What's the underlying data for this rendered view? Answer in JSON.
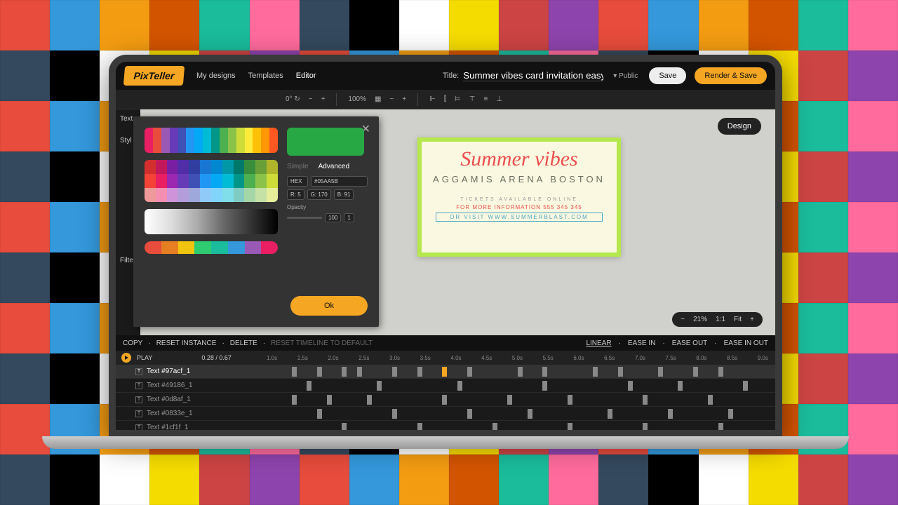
{
  "header": {
    "logo": "PixTeller",
    "nav": {
      "mydesigns": "My designs",
      "templates": "Templates",
      "editor": "Editor"
    },
    "title_label": "Title:",
    "title_value": "Summer vibes card invitation easy to customiz",
    "visibility": "Public",
    "save": "Save",
    "render": "Render & Save"
  },
  "toolbar": {
    "zoom": "100%"
  },
  "sidebar": {
    "text": "Text",
    "style": "Styl",
    "filter": "Filte"
  },
  "canvas": {
    "design_btn": "Design",
    "card": {
      "title": "Summer vibes",
      "subtitle": "AGGAMIS ARENA BOSTON",
      "tickets": "TICKETS AVAILABLE ONLINE",
      "info": "FOR MORE INFORMATION 555 345 345",
      "link": "OR VISIT WWW.SUMMERBLAST.COM"
    },
    "zoom": {
      "minus": "−",
      "pct": "21%",
      "one": "1:1",
      "fit": "Fit",
      "plus": "+"
    }
  },
  "colorpicker": {
    "simple": "Simple",
    "advanced": "Advanced",
    "hex_label": "HEX",
    "hex_value": "#05AA5B",
    "r_label": "R:",
    "r_value": "5",
    "g_label": "G:",
    "g_value": "170",
    "b_label": "B:",
    "b_value": "91",
    "opacity_label": "Opacity",
    "opacity_value": "100",
    "opacity_step": "1",
    "ok": "Ok"
  },
  "timeline": {
    "actions": {
      "copy": "COPY",
      "reset": "RESET INSTANCE",
      "delete": "DELETE",
      "reset_tl": "RESET TIMELINE TO DEFAULT"
    },
    "easing": {
      "linear": "LINEAR",
      "easein": "EASE IN",
      "easeout": "EASE OUT",
      "easeinout": "EASE IN OUT"
    },
    "play": "PLAY",
    "time": "0.28 / 0.67",
    "marks": [
      "1.0s",
      "1.5s",
      "2.0s",
      "2.5s",
      "3.0s",
      "3.5s",
      "4.0s",
      "4.5s",
      "5.0s",
      "5.5s",
      "6.0s",
      "6.5s",
      "7.0s",
      "7.5s",
      "8.0s",
      "8.5s",
      "9.0s"
    ],
    "layers": [
      "Text #97acf_1",
      "Text #49186_1",
      "Text #0d8af_1",
      "Text #0833e_1",
      "Text #1cf1f_1"
    ]
  }
}
